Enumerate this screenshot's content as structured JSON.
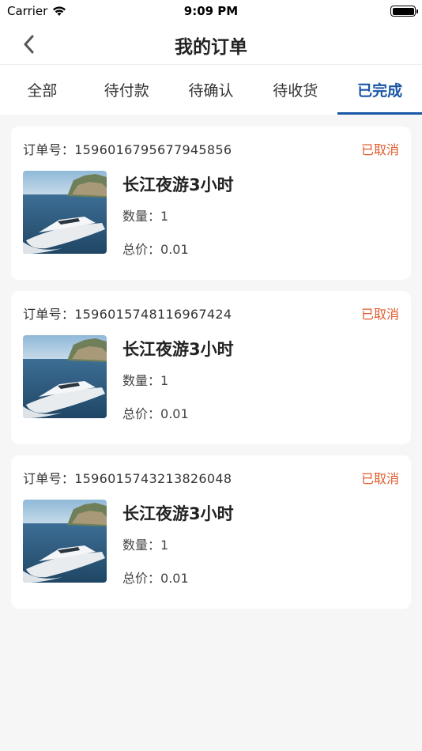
{
  "status_bar": {
    "carrier": "Carrier",
    "time": "9:09 PM"
  },
  "header": {
    "title": "我的订单"
  },
  "tabs": [
    {
      "label": "全部",
      "active": false
    },
    {
      "label": "待付款",
      "active": false
    },
    {
      "label": "待确认",
      "active": false
    },
    {
      "label": "待收货",
      "active": false
    },
    {
      "label": "已完成",
      "active": true
    }
  ],
  "labels": {
    "order_no": "订单号：",
    "quantity": "数量：",
    "total": "总价："
  },
  "orders": [
    {
      "order_no": "1596016795677945856",
      "status": "已取消",
      "product": "长江夜游3小时",
      "quantity": "1",
      "total": "0.01"
    },
    {
      "order_no": "1596015748116967424",
      "status": "已取消",
      "product": "长江夜游3小时",
      "quantity": "1",
      "total": "0.01"
    },
    {
      "order_no": "1596015743213826048",
      "status": "已取消",
      "product": "长江夜游3小时",
      "quantity": "1",
      "total": "0.01"
    }
  ],
  "colors": {
    "accent": "#1a56a6",
    "status_cancelled": "#e05a2b",
    "background": "#f6f6f6"
  }
}
